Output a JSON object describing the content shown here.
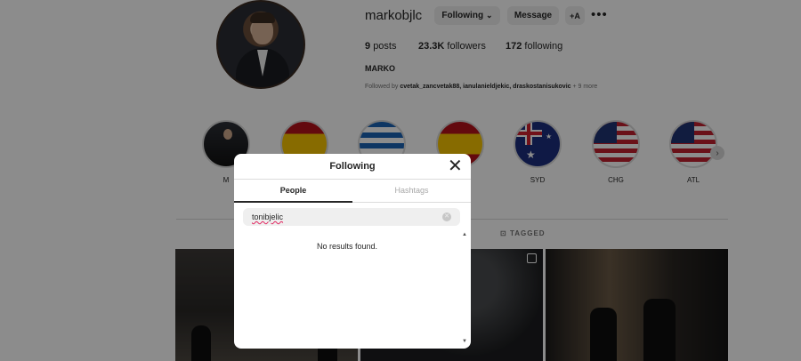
{
  "profile": {
    "username": "markobjlc",
    "following_button": "Following",
    "chevron": "⌄",
    "message_button": "Message",
    "add_user_icon": "+A",
    "more_icon": "•••",
    "posts_count": "9",
    "posts_label": "posts",
    "followers_count": "23.3K",
    "followers_label": "followers",
    "following_count": "172",
    "following_label": "following",
    "bio_name": "MARKO",
    "followed_by_prefix": "Followed by",
    "followed_by_names": "cvetak_zancvetak88, ianulanieldjekic, draskostanisukovic",
    "followed_by_more": "+ 9 more"
  },
  "highlights": [
    {
      "label": "M",
      "icon": "suit-photo"
    },
    {
      "label": "",
      "icon": "spain-flag"
    },
    {
      "label": "",
      "icon": "greece-flag"
    },
    {
      "label": "",
      "icon": "spain-flag"
    },
    {
      "label": "SYD",
      "icon": "australia-flag"
    },
    {
      "label": "CHG",
      "icon": "usa-flag"
    },
    {
      "label": "ATL",
      "icon": "usa-flag"
    }
  ],
  "tabs": {
    "tagged_label": "TAGGED"
  },
  "modal": {
    "title": "Following",
    "close_icon": "✕",
    "tab_people": "People",
    "tab_hashtags": "Hashtags",
    "search_value": "tonibjelic",
    "clear_icon": "✕",
    "no_results": "No results found."
  }
}
